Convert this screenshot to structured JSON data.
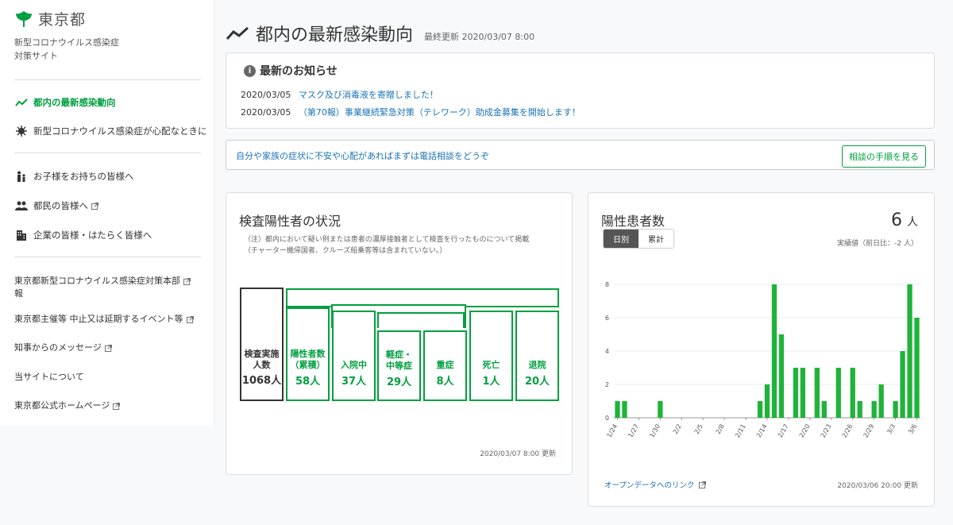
{
  "sidebar": {
    "logo_text": "東京都",
    "site_title_line1": "新型コロナウイルス感染症",
    "site_title_line2": "対策サイト",
    "nav_primary": [
      {
        "label": "都内の最新感染動向"
      },
      {
        "label": "新型コロナウイルス感染症が心配なときに"
      }
    ],
    "nav_secondary": [
      {
        "label": "お子様をお持ちの皆様へ"
      },
      {
        "label": "都民の皆様へ"
      },
      {
        "label": "企業の皆様・はたらく皆様へ"
      }
    ],
    "nav_links": [
      {
        "label_line1": "東京都新型コロナウイルス感染症対策本部",
        "label_line2": "報"
      },
      {
        "label_line1": "東京都主催等 中止又は延期するイベント等",
        "label_line2": ""
      },
      {
        "label_line1": "知事からのメッセージ",
        "label_line2": ""
      },
      {
        "label_line1": "当サイトについて",
        "label_line2": ""
      },
      {
        "label_line1": "東京都公式ホームページ",
        "label_line2": ""
      }
    ]
  },
  "header": {
    "title": "都内の最新感染動向",
    "last_updated": "最終更新 2020/03/07 8:00"
  },
  "news": {
    "title": "最新のお知らせ",
    "items": [
      {
        "date": "2020/03/05",
        "text": "マスク及び消毒液を寄贈しました！"
      },
      {
        "date": "2020/03/05",
        "text": "（第70報）事業継続緊急対策（テレワーク）助成金募集を開始します！"
      }
    ]
  },
  "consult": {
    "text": "自分や家族の症状に不安や心配があればまずは電話相談をどうぞ",
    "button": "相談の手順を見る"
  },
  "status_card": {
    "title": "検査陽性者の状況",
    "note_line1": "（注）都内において疑い例または患者の濃厚接触者として検査を行ったものについて掲載",
    "note_line2": "（チャーター機帰国者、クルーズ船乗客等は含まれていない。）",
    "boxes": {
      "tested": {
        "label1": "検査実施",
        "label2": "人数",
        "value": "1068人"
      },
      "positive": {
        "label1": "陽性者数",
        "label2": "（累積）",
        "value": "58人"
      },
      "hospitalized": {
        "label1": "入院中",
        "label2": "",
        "value": "37人"
      },
      "mild": {
        "label1": "軽症・",
        "label2": "中等症",
        "value": "29人"
      },
      "severe": {
        "label1": "重症",
        "label2": "",
        "value": "8人"
      },
      "deaths": {
        "label1": "死亡",
        "label2": "",
        "value": "1人"
      },
      "discharged": {
        "label1": "退院",
        "label2": "",
        "value": "20人"
      }
    },
    "footer": "2020/03/07 8:00 更新"
  },
  "patients_card": {
    "title": "陽性患者数",
    "total": "6",
    "total_unit": "人",
    "sub": "実績値（前日比：-2 人）",
    "toggle_daily": "日別",
    "toggle_cumulative": "累計",
    "open_data_link": "オープンデータへのリンク",
    "footer": "2020/03/06 20:00 更新"
  },
  "colors": {
    "accent": "#00a040",
    "link": "#1a73b5",
    "bar": "#1fb33a"
  },
  "chart_data": {
    "type": "bar",
    "categories": [
      "1/24",
      "1/25",
      "1/26",
      "1/27",
      "1/28",
      "1/29",
      "1/30",
      "1/31",
      "2/1",
      "2/2",
      "2/3",
      "2/4",
      "2/5",
      "2/6",
      "2/7",
      "2/8",
      "2/9",
      "2/10",
      "2/11",
      "2/12",
      "2/13",
      "2/14",
      "2/15",
      "2/16",
      "2/17",
      "2/18",
      "2/19",
      "2/20",
      "2/21",
      "2/22",
      "2/23",
      "2/24",
      "2/25",
      "2/26",
      "2/27",
      "2/28",
      "2/29",
      "3/1",
      "3/2",
      "3/3",
      "3/4",
      "3/5",
      "3/6"
    ],
    "tick_labels": [
      "1/24",
      "1/27",
      "1/30",
      "2/2",
      "2/5",
      "2/8",
      "2/11",
      "2/14",
      "2/17",
      "2/20",
      "2/23",
      "2/26",
      "2/29",
      "3/3",
      "3/6"
    ],
    "values": [
      1,
      1,
      0,
      0,
      0,
      0,
      1,
      0,
      0,
      0,
      0,
      0,
      0,
      0,
      0,
      0,
      0,
      0,
      0,
      0,
      1,
      2,
      8,
      5,
      0,
      3,
      3,
      0,
      3,
      1,
      0,
      3,
      0,
      3,
      1,
      0,
      1,
      2,
      0,
      1,
      4,
      8,
      6
    ],
    "ylim": [
      0,
      8
    ],
    "yticks": [
      0,
      2,
      4,
      6,
      8
    ],
    "grid": true
  }
}
